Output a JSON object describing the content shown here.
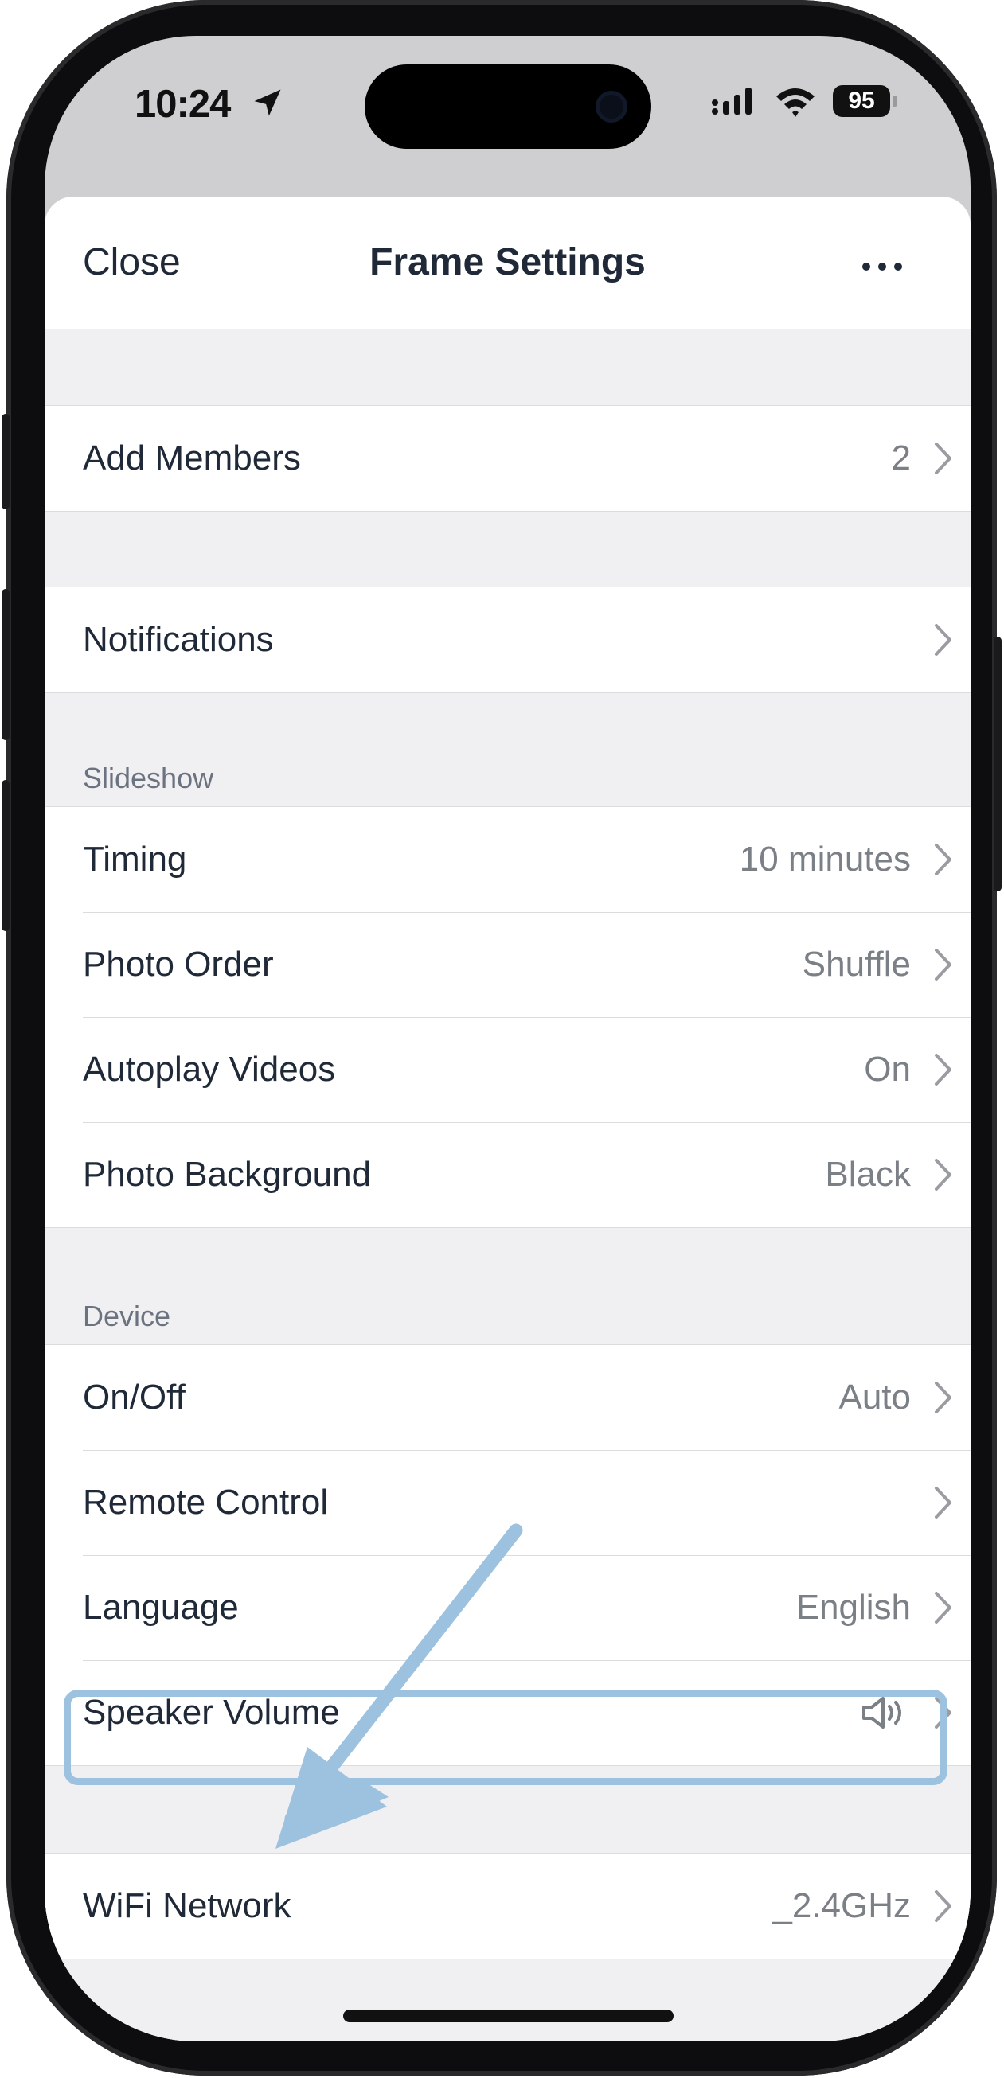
{
  "status_bar": {
    "time": "10:24",
    "battery": "95"
  },
  "nav": {
    "close": "Close",
    "title": "Frame Settings"
  },
  "members": {
    "label": "Add Members",
    "value": "2"
  },
  "notifications": {
    "label": "Notifications"
  },
  "slideshow": {
    "header": "Slideshow",
    "items": [
      {
        "label": "Timing",
        "value": "10 minutes"
      },
      {
        "label": "Photo Order",
        "value": "Shuffle"
      },
      {
        "label": "Autoplay Videos",
        "value": "On"
      },
      {
        "label": "Photo Background",
        "value": "Black"
      }
    ]
  },
  "device": {
    "header": "Device",
    "items": [
      {
        "label": "On/Off",
        "value": "Auto"
      },
      {
        "label": "Remote Control",
        "value": ""
      },
      {
        "label": "Language",
        "value": "English"
      },
      {
        "label": "Speaker Volume",
        "value": ""
      }
    ]
  },
  "wifi": {
    "label": "WiFi Network",
    "value": "_2.4GHz"
  },
  "colors": {
    "highlight": "#9cc2df",
    "arrow": "#9cc2df"
  }
}
